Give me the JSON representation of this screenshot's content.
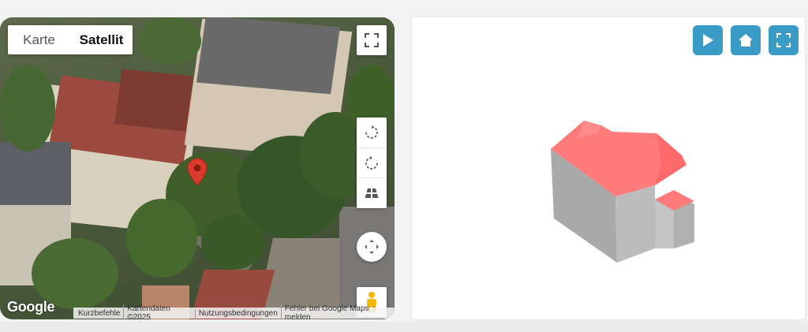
{
  "map": {
    "type_tabs": [
      {
        "label": "Karte",
        "active": false
      },
      {
        "label": "Satellit",
        "active": true
      }
    ],
    "logo_text": "Google",
    "attribution": [
      "Kurzbefehle",
      "Kartendaten ©2025",
      "Nutzungsbedingungen",
      "Fehler bei Google Maps melden"
    ],
    "icons": {
      "fullscreen": "fullscreen-icon",
      "rotate_cw": "rotate-clockwise-icon",
      "rotate_ccw": "rotate-counterclockwise-icon",
      "tilt": "tilt-icon",
      "pan": "pan-arrows-icon",
      "pegman": "street-view-pegman-icon",
      "marker": "location-marker-icon"
    },
    "colors": {
      "marker": "#d93a2b",
      "pegman": "#f2b705"
    }
  },
  "viewer": {
    "buttons": [
      {
        "name": "play-button",
        "icon": "play-icon"
      },
      {
        "name": "home-button",
        "icon": "home-icon"
      },
      {
        "name": "fullscreen-button",
        "icon": "fullscreen-icon"
      }
    ],
    "colors": {
      "button": "#3a9cc6",
      "roof": "#ff7a7a",
      "wall": "#a8a8a8"
    }
  }
}
